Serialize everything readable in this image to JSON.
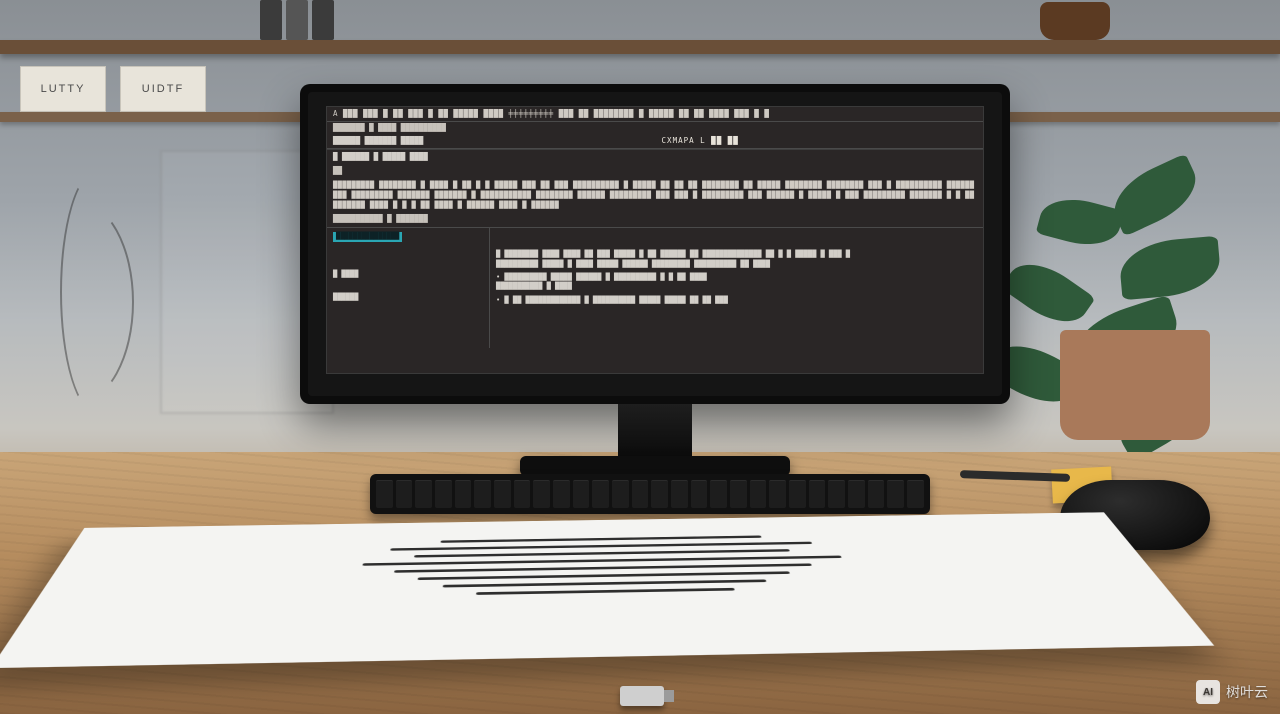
{
  "shelf_labels": {
    "label1": "LUTTY",
    "label2": "UIDTF"
  },
  "screen": {
    "titlebar": "A  ███ ███ █ ██ ███ █ ██ █████   ████   ╪╪╪╪╪╪╪╪╪   ███  ██ ████████ █ █████ ██ ██   ████   ███ █ █",
    "subtitle": "███████ █ ████ ██████████",
    "tabs_left": "██████   ███████   █████",
    "tabs_center": "CXMAPA  L ██  ██",
    "section_label": "█ ██████ █ █████ ████",
    "section_sub": "██",
    "paragraph": "█████████ ████████ █ ████ █ ██ █ █ █████ ███  ██ ███ ██████████ █ █████ ██ ██ ██   ████████ ██ █████ ████████\\n████████ ███ █ ██████████ ██████ ███ █████████ ███████ ███████ █ ███████████ ████████   ██████ █████████\\n███  ███ █  █████████   ███ ██████  █ █████ █   ███ █████████ ███████  █ █   ██ ███████ ████ █ █   █  ██\\n████  █  ██████  ████ █ ██████",
    "list_header": "███████████ █ ███████",
    "highlight": "███████████████",
    "lower_left_1": "█   ████",
    "lower_left_2": "██████",
    "lower_items": [
      "█ ████████ ████ ████ ██ ███ █████ █ ██ ██████ ██ ██████████████ ██ █ █ █████ █ ███ █",
      "  ██████████ █████ █ ████ █████ ██████ █████████ ██████████ ██ ████",
      "• ██████████ █████ ██████ █ ██████████ █ █ ██ ████",
      "  ███████████ █ ████",
      "• █ ██ █████████████ █ ██████████ █████ █████ ██ ██ ███"
    ]
  },
  "watermark": {
    "badge": "AI",
    "text": "树叶云"
  }
}
